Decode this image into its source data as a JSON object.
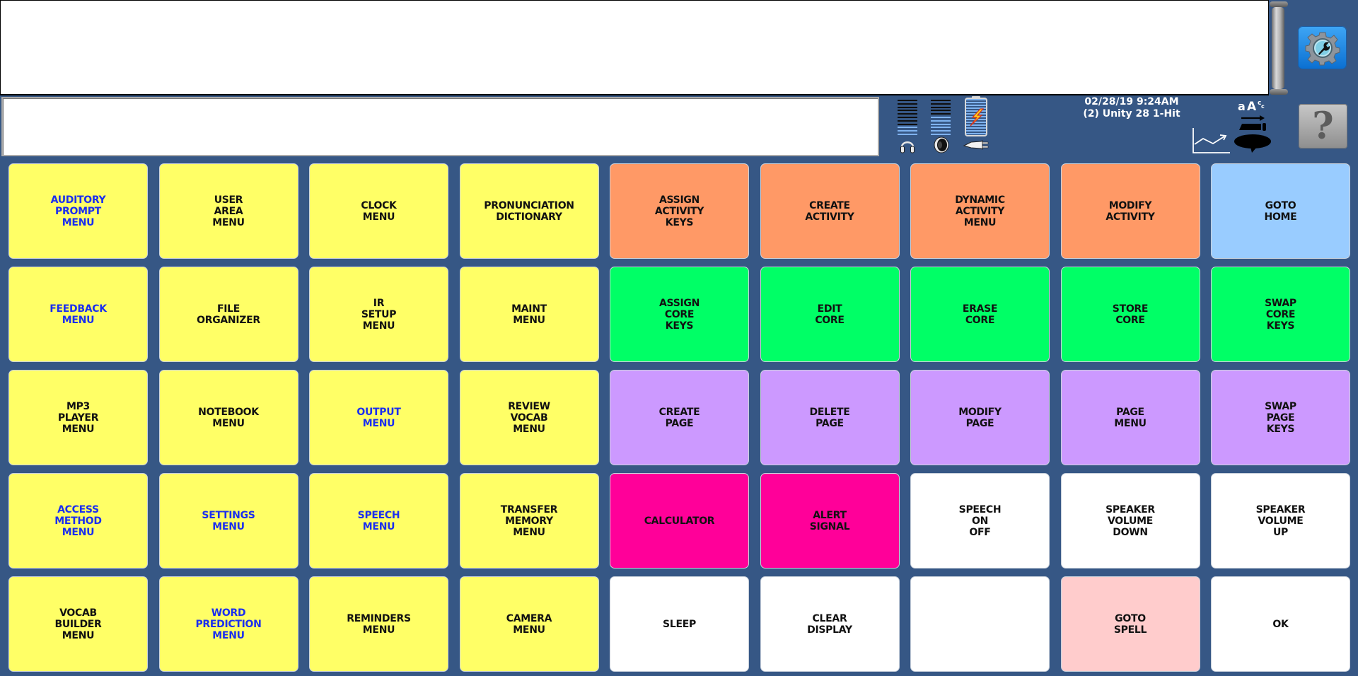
{
  "message_window": {
    "text": ""
  },
  "secondary_input": {
    "value": ""
  },
  "status": {
    "datetime": "02/28/19 9:24AM",
    "vocabulary": "(2) Unity 28 1-Hit",
    "headphone_volume_level": 3,
    "speaker_volume_level": 6,
    "meter_levels_total": 11,
    "battery_level_percent": 100,
    "battery_charging": true,
    "plugged_in": true
  },
  "icons": {
    "settings": "gear-wrench-icon",
    "help": "question-mark-icon",
    "headphones": "headphones-icon",
    "speaker": "speaker-icon",
    "battery": "battery-charging-icon",
    "plug": "power-plug-icon",
    "chart": "line-chart-icon",
    "text_case": "text-case-icon",
    "keyboard": "keyboard-icon",
    "speech": "speech-bubble-icon"
  },
  "help_label": "?",
  "colors": {
    "background": "#365785",
    "yellow": "#ffff66",
    "orange": "#ff9966",
    "green": "#00ff66",
    "purple": "#cc99ff",
    "magenta": "#ff0099",
    "light_blue": "#99ccff",
    "pink": "#ffcccc",
    "white": "#ffffff",
    "link_text": "#1a2ef0"
  },
  "keys": [
    {
      "label": "AUDITORY\nPROMPT\nMENU",
      "color": "yellow",
      "link": true
    },
    {
      "label": "USER\nAREA\nMENU",
      "color": "yellow",
      "link": false
    },
    {
      "label": "CLOCK\nMENU",
      "color": "yellow",
      "link": false
    },
    {
      "label": "PRONUNCIATION\nDICTIONARY",
      "color": "yellow",
      "link": false
    },
    {
      "label": "ASSIGN\nACTIVITY\nKEYS",
      "color": "orange",
      "link": false
    },
    {
      "label": "CREATE\nACTIVITY",
      "color": "orange",
      "link": false
    },
    {
      "label": "DYNAMIC\nACTIVITY\nMENU",
      "color": "orange",
      "link": false
    },
    {
      "label": "MODIFY\nACTIVITY",
      "color": "orange",
      "link": false
    },
    {
      "label": "GOTO\nHOME",
      "color": "light_blue",
      "link": false
    },
    {
      "label": "FEEDBACK\nMENU",
      "color": "yellow",
      "link": true
    },
    {
      "label": "FILE\nORGANIZER",
      "color": "yellow",
      "link": false
    },
    {
      "label": "IR\nSETUP\nMENU",
      "color": "yellow",
      "link": false
    },
    {
      "label": "MAINT\nMENU",
      "color": "yellow",
      "link": false
    },
    {
      "label": "ASSIGN\nCORE\nKEYS",
      "color": "green",
      "link": false
    },
    {
      "label": "EDIT\nCORE",
      "color": "green",
      "link": false
    },
    {
      "label": "ERASE\nCORE",
      "color": "green",
      "link": false
    },
    {
      "label": "STORE\nCORE",
      "color": "green",
      "link": false
    },
    {
      "label": "SWAP\nCORE\nKEYS",
      "color": "green",
      "link": false
    },
    {
      "label": "MP3\nPLAYER\nMENU",
      "color": "yellow",
      "link": false
    },
    {
      "label": "NOTEBOOK\nMENU",
      "color": "yellow",
      "link": false
    },
    {
      "label": "OUTPUT\nMENU",
      "color": "yellow",
      "link": true
    },
    {
      "label": "REVIEW\nVOCAB\nMENU",
      "color": "yellow",
      "link": false
    },
    {
      "label": "CREATE\nPAGE",
      "color": "purple",
      "link": false
    },
    {
      "label": "DELETE\nPAGE",
      "color": "purple",
      "link": false
    },
    {
      "label": "MODIFY\nPAGE",
      "color": "purple",
      "link": false
    },
    {
      "label": "PAGE\nMENU",
      "color": "purple",
      "link": false
    },
    {
      "label": "SWAP\nPAGE\nKEYS",
      "color": "purple",
      "link": false
    },
    {
      "label": "ACCESS\nMETHOD\nMENU",
      "color": "yellow",
      "link": true
    },
    {
      "label": "SETTINGS\nMENU",
      "color": "yellow",
      "link": true
    },
    {
      "label": "SPEECH\nMENU",
      "color": "yellow",
      "link": true
    },
    {
      "label": "TRANSFER\nMEMORY\nMENU",
      "color": "yellow",
      "link": false
    },
    {
      "label": "CALCULATOR",
      "color": "magenta",
      "link": false
    },
    {
      "label": "ALERT\nSIGNAL",
      "color": "magenta",
      "link": false
    },
    {
      "label": "SPEECH\nON\nOFF",
      "color": "white",
      "link": false
    },
    {
      "label": "SPEAKER\nVOLUME\nDOWN",
      "color": "white",
      "link": false
    },
    {
      "label": "SPEAKER\nVOLUME\nUP",
      "color": "white",
      "link": false
    },
    {
      "label": "VOCAB\nBUILDER\nMENU",
      "color": "yellow",
      "link": false
    },
    {
      "label": "WORD\nPREDICTION\nMENU",
      "color": "yellow",
      "link": true
    },
    {
      "label": "REMINDERS\nMENU",
      "color": "yellow",
      "link": false
    },
    {
      "label": "CAMERA\nMENU",
      "color": "yellow",
      "link": false
    },
    {
      "label": "SLEEP",
      "color": "white",
      "link": false
    },
    {
      "label": "CLEAR\nDISPLAY",
      "color": "white",
      "link": false
    },
    {
      "label": "",
      "color": "white",
      "link": false
    },
    {
      "label": "GOTO\nSPELL",
      "color": "pink",
      "link": false
    },
    {
      "label": "OK",
      "color": "white",
      "link": false
    }
  ]
}
